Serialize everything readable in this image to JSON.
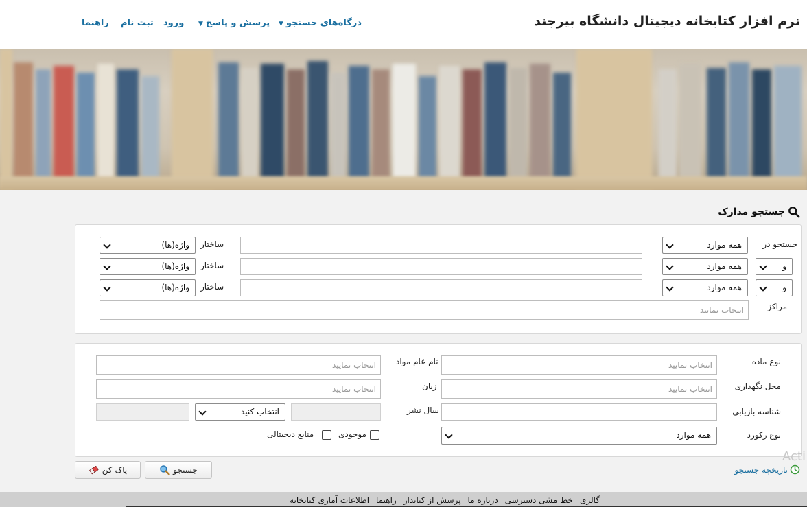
{
  "header": {
    "brand": "نرم افزار کتابخانه دیجیتال دانشگاه بیرجند",
    "nav": {
      "search_portals": "درگاه‌های جستجو",
      "qa": "پرسش و پاسخ",
      "login": "ورود",
      "register": "ثبت نام",
      "help": "راهنما"
    }
  },
  "section": {
    "title": "جستجو مدارک"
  },
  "search_panel": {
    "search_in_label": "جستجو در",
    "rows": [
      {
        "operator": "",
        "field": "همه موارد",
        "term": "",
        "structure_label": "ساختار",
        "structure": "واژه(ها)"
      },
      {
        "operator": "و",
        "field": "همه موارد",
        "term": "",
        "structure_label": "ساختار",
        "structure": "واژه(ها)"
      },
      {
        "operator": "و",
        "field": "همه موارد",
        "term": "",
        "structure_label": "ساختار",
        "structure": "واژه(ها)"
      }
    ],
    "centers_label": "مراکز",
    "centers_placeholder": "انتخاب نمایید"
  },
  "filters": {
    "material_type_label": "نوع ماده",
    "material_type_placeholder": "انتخاب نمایید",
    "general_name_label": "نام عام مواد",
    "general_name_placeholder": "انتخاب نمایید",
    "location_label": "محل نگهداری",
    "location_placeholder": "انتخاب نمایید",
    "language_label": "زبان",
    "language_placeholder": "انتخاب نمایید",
    "call_number_label": "شناسه بازیابی",
    "pub_year_label": "سال نشر",
    "year_select": "انتخاب کنید",
    "record_type_label": "نوع رکورد",
    "record_type": "همه موارد",
    "available_label": "موجودی",
    "digital_label": "منابع دیجیتالی"
  },
  "actions": {
    "search": "جستجو",
    "clear": "پاک کن",
    "history": "تاریخچه جستجو"
  },
  "watermark": "Acti",
  "footer": {
    "links": [
      "گالری",
      "خط مشی دسترسی",
      "درباره ما",
      "پرسش از کتابدار",
      "راهنما",
      "اطلاعات آماری کتابخانه"
    ]
  }
}
